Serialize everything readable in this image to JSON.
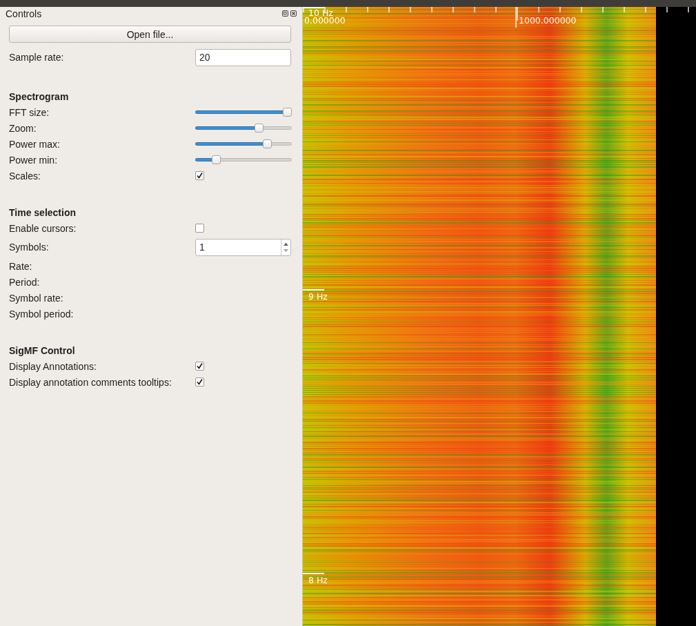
{
  "dock": {
    "title": "Controls"
  },
  "open_button": "Open file...",
  "sample_rate": {
    "label": "Sample rate:",
    "value": "20"
  },
  "sections": [
    {
      "title": "Spectrogram",
      "rows": [
        {
          "kind": "slider",
          "label": "FFT size:",
          "level": 1.0
        },
        {
          "kind": "slider",
          "label": "Zoom:",
          "level": 0.68
        },
        {
          "kind": "slider",
          "label": "Power max:",
          "level": 0.77
        },
        {
          "kind": "slider",
          "label": "Power min:",
          "level": 0.19
        },
        {
          "kind": "checkbox",
          "label": "Scales:",
          "checked": true
        }
      ]
    },
    {
      "title": "Time selection",
      "rows": [
        {
          "kind": "checkbox",
          "label": "Enable cursors:",
          "checked": false
        },
        {
          "kind": "spinbox",
          "label": "Symbols:",
          "value": "1"
        },
        {
          "kind": "label",
          "label": "Rate:"
        },
        {
          "kind": "label",
          "label": "Period:"
        },
        {
          "kind": "label",
          "label": "Symbol rate:"
        },
        {
          "kind": "label",
          "label": "Symbol period:"
        }
      ]
    },
    {
      "title": "SigMF Control",
      "rows": [
        {
          "kind": "checkbox",
          "label": "Display Annotations:",
          "checked": true
        },
        {
          "kind": "checkbox",
          "label": "Display annotation comments tooltips:",
          "checked": true
        }
      ]
    }
  ],
  "spectrogram": {
    "time_labels": [
      "0.000000",
      "1000.000000"
    ],
    "freq_labels": [
      "10 Hz",
      "9 Hz",
      "8 Hz"
    ]
  }
}
